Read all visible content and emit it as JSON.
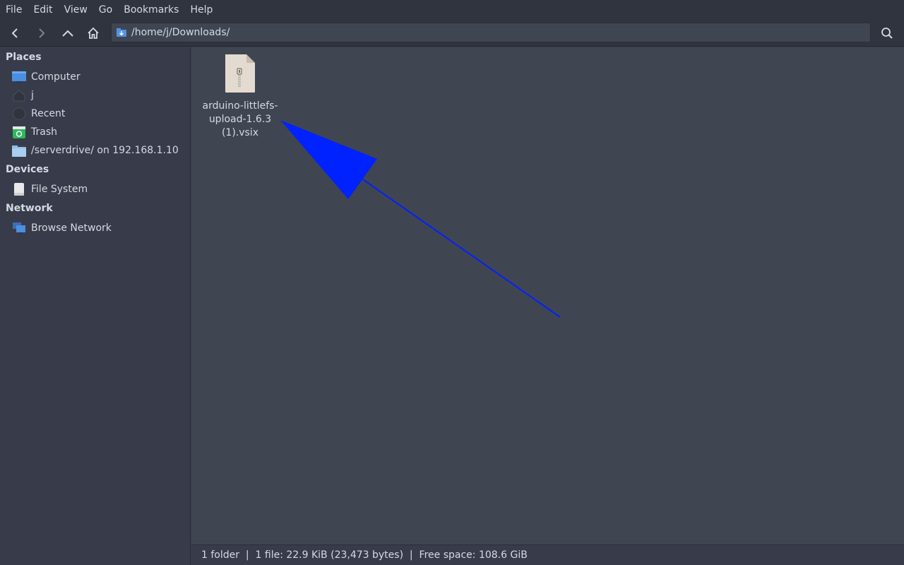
{
  "menubar": {
    "items": [
      "File",
      "Edit",
      "View",
      "Go",
      "Bookmarks",
      "Help"
    ]
  },
  "toolbar": {
    "back_icon": "chevron-left-icon",
    "forward_icon": "chevron-right-icon",
    "up_icon": "chevron-up-icon",
    "home_icon": "home-icon",
    "search_icon": "search-icon",
    "location": "/home/j/Downloads/"
  },
  "sidebar": {
    "sections": [
      {
        "heading": "Places",
        "items": [
          {
            "label": "Computer",
            "icon": "monitor-icon"
          },
          {
            "label": "j",
            "icon": "home-folder-icon"
          },
          {
            "label": "Recent",
            "icon": "clock-icon"
          },
          {
            "label": "Trash",
            "icon": "trash-icon"
          },
          {
            "label": "/serverdrive/ on 192.168.1.10",
            "icon": "network-folder-icon"
          }
        ]
      },
      {
        "heading": "Devices",
        "items": [
          {
            "label": "File System",
            "icon": "drive-icon"
          }
        ]
      },
      {
        "heading": "Network",
        "items": [
          {
            "label": "Browse Network",
            "icon": "network-icon"
          }
        ]
      }
    ]
  },
  "content": {
    "files": [
      {
        "name": "arduino-littlefs-upload-1.6.3 (1).vsix",
        "name_line1": "arduino-littlefs-",
        "name_line2": "upload-1.6.3 (1).vsix",
        "icon": "zip-archive-icon"
      }
    ]
  },
  "statusbar": {
    "text": "1 folder  |  1 file: 22.9 KiB (23,473 bytes)  |  Free space: 108.6 GiB"
  },
  "colors": {
    "background": "#383c4a",
    "content_background": "#404552",
    "toolbar_background": "#2f343f",
    "text": "#d3dae3",
    "annotation_arrow": "#0022ff"
  }
}
